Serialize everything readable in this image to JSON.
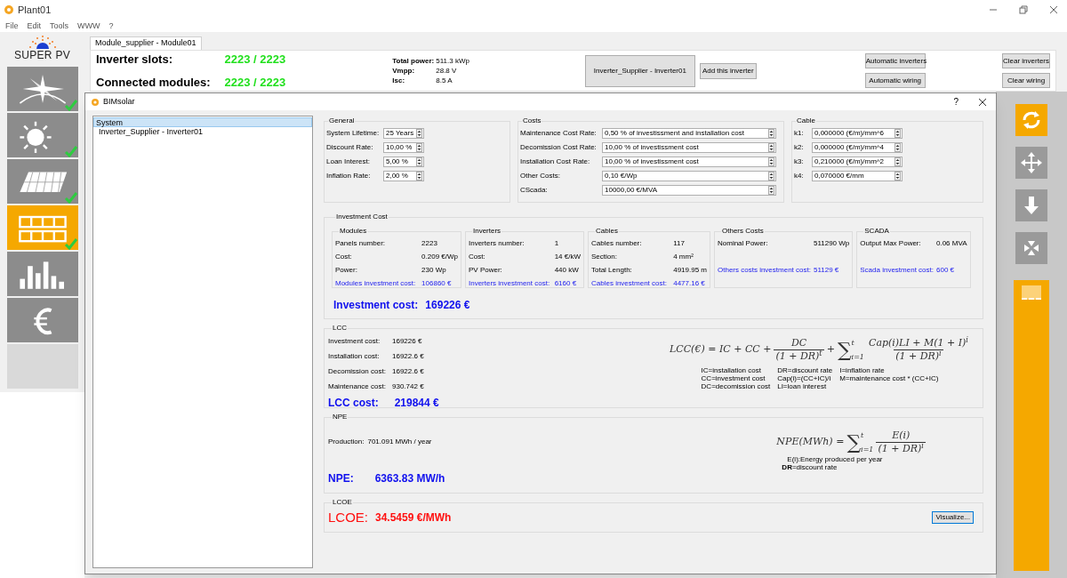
{
  "window": {
    "title": "Plant01"
  },
  "menu": [
    "File",
    "Edit",
    "Tools",
    "WWW",
    "?"
  ],
  "logo": {
    "text": "SUPER PV"
  },
  "tools": [
    {
      "kind": "compass",
      "selected": false,
      "done": true
    },
    {
      "kind": "sun",
      "selected": false,
      "done": true
    },
    {
      "kind": "panels",
      "selected": false,
      "done": true
    },
    {
      "kind": "wiring",
      "selected": true,
      "done": true
    },
    {
      "kind": "chart",
      "selected": false,
      "done": false
    },
    {
      "kind": "euro",
      "selected": false,
      "done": false
    },
    {
      "kind": "empty",
      "selected": false,
      "done": false
    }
  ],
  "module_tab": {
    "label": "Module_supplier - Module01"
  },
  "summary": [
    {
      "label": "Inverter slots:",
      "value": "2223 / 2223"
    },
    {
      "label": "Connected modules:",
      "value": "2223 / 2223"
    }
  ],
  "specs": [
    {
      "label": "Total power:",
      "value": "511.3 kWp"
    },
    {
      "label": "Vmpp:",
      "value": "28.8 V"
    },
    {
      "label": "Isc:",
      "value": "8.5 A"
    }
  ],
  "inverter_selector": "Inverter_Supplier - Inverter01",
  "add_button": "Add this inverter",
  "auto_buttons": [
    "Automatic inverters",
    "Automatic wiring"
  ],
  "clear_buttons": [
    "Clear inverters",
    "Clear wiring"
  ],
  "dialog": {
    "title": "BIMsolar",
    "help": "?",
    "tree": [
      {
        "label": "System",
        "selected": true,
        "children": [
          {
            "label": "Inverter_Supplier - Inverter01",
            "selected": false
          }
        ]
      }
    ],
    "general": {
      "title": "General",
      "fields": [
        {
          "label": "System Lifetime:",
          "value": "25 Years"
        },
        {
          "label": "Discount Rate:",
          "value": "10,00 %"
        },
        {
          "label": "Loan Interest:",
          "value": "5,00 %"
        },
        {
          "label": "Inflation Rate:",
          "value": "2,00 %"
        }
      ]
    },
    "costs": {
      "title": "Costs",
      "fields": [
        {
          "label": "Maintenance Cost Rate:",
          "value": "0,50 % of investissment and installation cost"
        },
        {
          "label": "Decomission Cost Rate:",
          "value": "10,00 % of investissment cost"
        },
        {
          "label": "Installation Cost Rate:",
          "value": "10,00 % of investissment cost"
        },
        {
          "label": "Other Costs:",
          "value": "0,10 €/Wp"
        },
        {
          "label": "CScada:",
          "value": "10000,00 €/MVA"
        }
      ]
    },
    "cable": {
      "title": "Cable",
      "fields": [
        {
          "label": "k1:",
          "value": "0,000000 (€/m)/mm^6"
        },
        {
          "label": "k2:",
          "value": "0,000000 (€/m)/mm^4"
        },
        {
          "label": "k3:",
          "value": "0,210000 (€/m)/mm^2"
        },
        {
          "label": "k4:",
          "value": "0,070000 €/mm"
        }
      ]
    },
    "investment": {
      "title": "Investment Cost",
      "groups": [
        {
          "title": "Modules",
          "rows": [
            {
              "label": "Panels number:",
              "value": "2223"
            },
            {
              "label": "Cost:",
              "value": "0.209 €/Wp"
            },
            {
              "label": "Power:",
              "value": "230 Wp"
            }
          ],
          "total": {
            "label": "Modules investment cost:",
            "value": "106860 €"
          }
        },
        {
          "title": "Inverters",
          "rows": [
            {
              "label": "Inverters number:",
              "value": "1"
            },
            {
              "label": "Cost:",
              "value": "14 €/kW"
            },
            {
              "label": "PV Power:",
              "value": "440 kW"
            }
          ],
          "total": {
            "label": "Inverters investment cost:",
            "value": "6160 €"
          }
        },
        {
          "title": "Cables",
          "rows": [
            {
              "label": "Cables number:",
              "value": "117"
            },
            {
              "label": "Section:",
              "value": "4 mm²"
            },
            {
              "label": "Total Length:",
              "value": "4919.95 m"
            }
          ],
          "total": {
            "label": "Cables investment cost:",
            "value": "4477.16 €"
          }
        },
        {
          "title": "Others Costs",
          "rows": [
            {
              "label": "Nominal Power:",
              "value": "511290 Wp"
            }
          ],
          "total": {
            "label": "Others costs investment cost:",
            "value": "51129 €"
          }
        },
        {
          "title": "SCADA",
          "rows": [
            {
              "label": "Output Max Power:",
              "value": "0.06 MVA"
            }
          ],
          "total": {
            "label": "Scada investment cost:",
            "value": "600 €"
          }
        }
      ],
      "result": {
        "label": "Investment cost:",
        "value": "169226 €"
      }
    },
    "lcc": {
      "title": "LCC",
      "rows": [
        {
          "label": "Investment cost:",
          "value": "169226 €"
        },
        {
          "label": "Installation cost:",
          "value": "16922.6 €"
        },
        {
          "label": "Decomission cost:",
          "value": "16922.6 €"
        },
        {
          "label": "Maintenance cost:",
          "value": "930.742 €"
        }
      ],
      "result": {
        "label": "LCC cost:",
        "value": "219844 €"
      },
      "formula": [
        {
          "kind": "text",
          "text": "LCC(€) = IC + CC +"
        },
        {
          "kind": "frac",
          "num": "DC",
          "den": "(1 + DR)$^{t}$"
        },
        {
          "kind": "text",
          "text": "+"
        },
        {
          "kind": "sum",
          "sign": "∑",
          "upper": "t",
          "lower": "i=1"
        },
        {
          "kind": "frac",
          "num": "Cap(i)LI + M(1 + I)$^{i}$",
          "den": "(1 + DR)$^{i}$"
        }
      ],
      "legend": [
        "IC=installation cost",
        "DR=discount rate",
        "I=inflation rate",
        "CC=investment cost",
        "Cap(i)=(CC+IC)/i",
        "M=maintenance cost * (CC+IC)",
        "DC=decomission cost",
        "LI=loan interest"
      ]
    },
    "npe": {
      "title": "NPE",
      "production": {
        "label": "Production:",
        "value": "701.091 MWh / year"
      },
      "result": {
        "label": "NPE:",
        "value": "6363.83 MW/h"
      },
      "formula": [
        {
          "kind": "text",
          "text": "NPE(MWh) ="
        },
        {
          "kind": "sum",
          "sign": "∑",
          "upper": "t",
          "lower": "i=1"
        },
        {
          "kind": "frac",
          "num": "E(i)",
          "den": "(1 + DR)$^{i}$"
        }
      ],
      "legend": [
        "E(i):Energy produced per year",
        "**DR**=discount rate"
      ]
    },
    "lcoe": {
      "title": "LCOE",
      "label": "LCOE:",
      "value": "34.5459 €/MWh",
      "button": "Visualize..."
    }
  }
}
